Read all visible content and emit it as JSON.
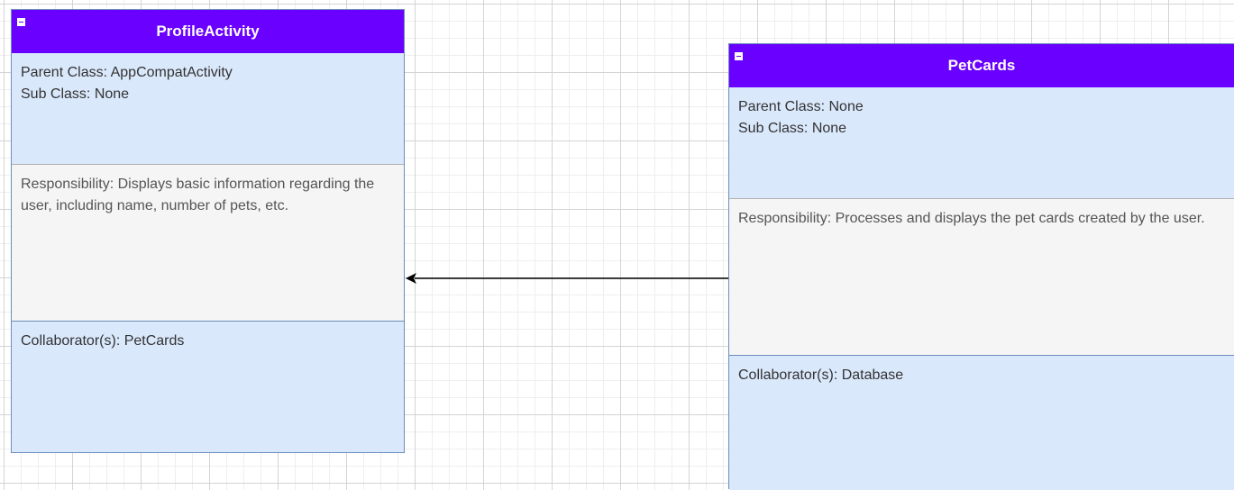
{
  "cards": {
    "profile_activity": {
      "title": "ProfileActivity",
      "parent_class": "Parent Class: AppCompatActivity",
      "sub_class": "Sub Class: None",
      "responsibility": "Responsibility: Displays basic information regarding the user, including name, number of pets, etc.",
      "collaborators": "Collaborator(s): PetCards"
    },
    "pet_cards": {
      "title": "PetCards",
      "parent_class": "Parent Class: None",
      "sub_class": "Sub Class: None",
      "responsibility": "Responsibility:  Processes and displays the pet cards created by the user.",
      "collaborators": "Collaborator(s): Database"
    }
  },
  "colors": {
    "header": "#6a00ff",
    "section_blue": "#dae8fc",
    "section_grey": "#f5f5f5",
    "border_blue": "#6c8ebf",
    "arrow": "#000000"
  },
  "icons": {
    "collapse": "minus-square-icon",
    "arrow": "arrowhead-left-icon"
  }
}
